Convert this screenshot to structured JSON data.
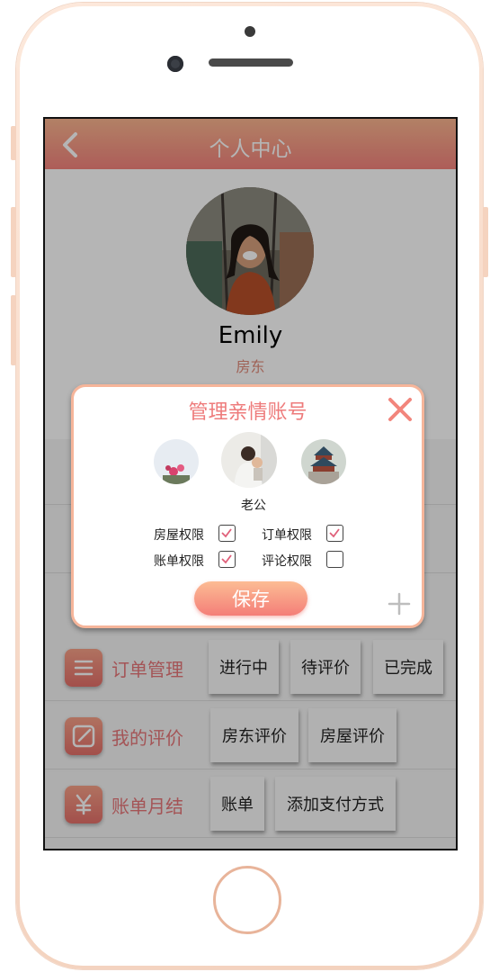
{
  "header": {
    "title": "个人中心"
  },
  "profile": {
    "name": "Emily",
    "role": "房东"
  },
  "rows": [
    {
      "label": "订单管理",
      "icon": "list-icon",
      "tags": [
        "进行中",
        "待评价",
        "已完成"
      ]
    },
    {
      "label": "我的评价",
      "icon": "edit-icon",
      "tags": [
        "房东评价",
        "房屋评价"
      ]
    },
    {
      "label": "账单月结",
      "icon": "yen-icon",
      "tags": [
        "账单",
        "添加支付方式"
      ]
    }
  ],
  "modal": {
    "title": "管理亲情账号",
    "selected_member": "老公",
    "permissions": [
      {
        "label": "房屋权限",
        "checked": true
      },
      {
        "label": "订单权限",
        "checked": true
      },
      {
        "label": "账单权限",
        "checked": true
      },
      {
        "label": "评论权限",
        "checked": false
      }
    ],
    "save_label": "保存"
  },
  "colors": {
    "accent": "#f4837d",
    "accent_light": "#fbb690",
    "title_pink": "#ee7b7b"
  }
}
